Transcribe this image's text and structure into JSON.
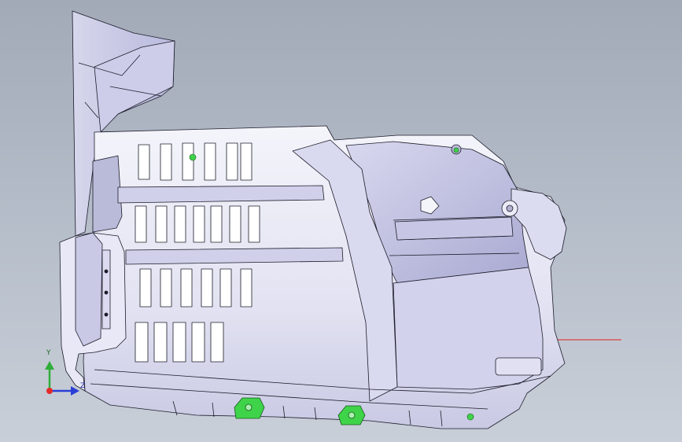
{
  "viewport": {
    "background_top": "#a2aab8",
    "background_bottom": "#c9cfd8"
  },
  "model": {
    "body_color": "#e6e6f5",
    "body_shade_color": "#c4c4e2",
    "edge_color": "#1c1c2a",
    "clip_color": "#3fd34a",
    "reference_line_color": "#e02020"
  },
  "triad": {
    "y_label": "Y",
    "z_label": "Z",
    "x_color": "#e52a2a",
    "y_color": "#2fae3a",
    "z_color": "#2a3fd6"
  }
}
